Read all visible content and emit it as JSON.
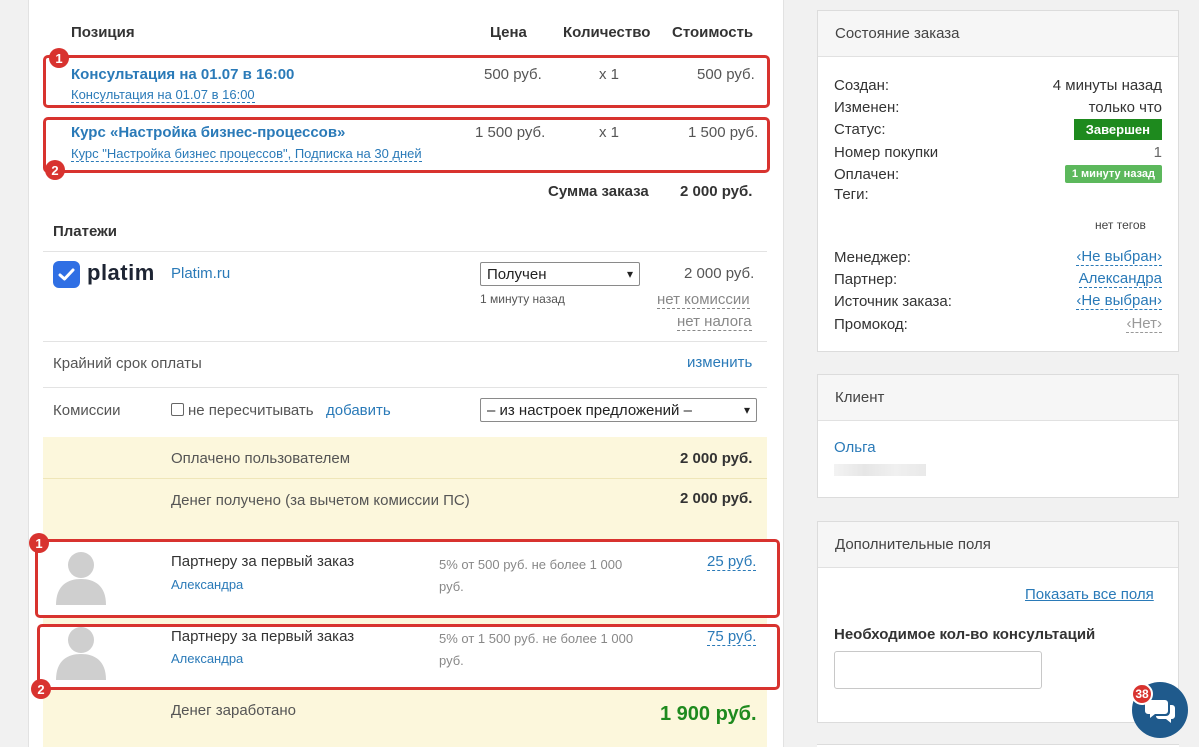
{
  "table": {
    "headers": {
      "position": "Позиция",
      "price": "Цена",
      "qty": "Количество",
      "cost": "Стоимость"
    },
    "rows": [
      {
        "title": "Консультация на 01.07 в 16:00",
        "subtitle": "Консультация на 01.07 в 16:00",
        "price": "500 руб.",
        "qty": "x 1",
        "cost": "500 руб.",
        "marker": "1"
      },
      {
        "title": "Курс «Настройка бизнес-процессов»",
        "subtitle": "Курс \"Настройка бизнес процессов\", Подписка на 30 дней",
        "price": "1 500 руб.",
        "qty": "x 1",
        "cost": "1 500 руб.",
        "marker": "2"
      }
    ],
    "total_label": "Сумма заказа",
    "total_value": "2 000 руб."
  },
  "payments": {
    "heading": "Платежи",
    "logo_text": "platim",
    "provider_link": "Platim.ru",
    "status_select": "Получен",
    "time": "1 минуту назад",
    "amount": "2 000 руб.",
    "commission": "нет комиссии",
    "tax": "нет налога"
  },
  "deadline": {
    "label": "Крайний срок оплаты",
    "action": "изменить"
  },
  "commissions": {
    "label": "Комиссии",
    "checkbox_label": "не пересчитывать",
    "add_link": "добавить",
    "select_value": "– из настроек предложений –"
  },
  "summary": {
    "paid_label": "Оплачено пользователем",
    "paid_value": "2 000 руб.",
    "received_label": "Денег получено (за вычетом комиссии ПС)",
    "received_value": "2 000 руб.",
    "partners": [
      {
        "title": "Партнеру за первый заказ",
        "name": "Александра",
        "desc": "5% от 500 руб. не более 1 000 руб.",
        "amount": "25 руб.",
        "marker": "1"
      },
      {
        "title": "Партнеру за первый заказ",
        "name": "Александра",
        "desc": "5% от 1 500 руб. не более 1 000 руб.",
        "amount": "75 руб.",
        "marker": "2"
      }
    ],
    "earned_label": "Денег заработано",
    "earned_value": "1 900 руб."
  },
  "order_state": {
    "heading": "Состояние заказа",
    "created_label": "Создан:",
    "created_value": "4 минуты назад",
    "changed_label": "Изменен:",
    "changed_value": "только что",
    "status_label": "Статус:",
    "status_value": "Завершен",
    "purchase_label": "Номер покупки",
    "purchase_value": "1",
    "paid_label": "Оплачен:",
    "paid_value": "1 минуту назад",
    "tags_label": "Теги:",
    "tags_value": "нет тегов",
    "manager_label": "Менеджер:",
    "manager_value": "‹Не выбран›",
    "partner_label": "Партнер:",
    "partner_value": "Александра",
    "source_label": "Источник заказа:",
    "source_value": "‹Не выбран›",
    "promo_label": "Промокод:",
    "promo_value": "‹Нет›"
  },
  "client": {
    "heading": "Клиент",
    "name": "Ольга"
  },
  "extra": {
    "heading": "Дополнительные поля",
    "show_all": "Показать все поля",
    "field_label": "Необходимое кол-во консультаций",
    "field_value": ""
  },
  "chat": {
    "count": "38"
  },
  "colors": {
    "accent": "#2a7ab8",
    "status_green": "#1e8a1e",
    "paid_green": "#5cb85c",
    "marker_red": "#d8332f",
    "highlight": "#fcf7dc"
  }
}
